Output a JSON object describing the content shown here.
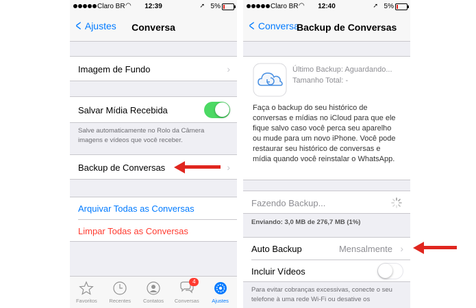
{
  "colors": {
    "ios_blue": "#007aff",
    "ios_red": "#ff3b30",
    "switch_green": "#4cd964",
    "arrow_red": "#e0261f",
    "group_bg": "#efeff4"
  },
  "left": {
    "status": {
      "carrier": "Claro BR",
      "time": "12:39",
      "battery": "5%"
    },
    "nav": {
      "back_label": "Ajustes",
      "title": "Conversa"
    },
    "imagem_fundo": "Imagem de Fundo",
    "salvar_midia": {
      "label": "Salvar Mídia Recebida",
      "on": true
    },
    "salvar_footer": "Salve automaticamente no Rolo da Câmera imagens e vídeos que você receber.",
    "backup_conversas": "Backup de Conversas",
    "arquivar": "Arquivar Todas as Conversas",
    "limpar": "Limpar Todas as Conversas",
    "tabs": [
      {
        "label": "Favoritos",
        "icon": "star-icon"
      },
      {
        "label": "Recentes",
        "icon": "clock-icon"
      },
      {
        "label": "Contatos",
        "icon": "contacts-icon"
      },
      {
        "label": "Conversas",
        "icon": "chat-bubbles-icon",
        "badge": "4"
      },
      {
        "label": "Ajustes",
        "icon": "settings-gear-icon",
        "active": true
      }
    ]
  },
  "right": {
    "status": {
      "carrier": "Claro BR",
      "time": "12:40",
      "battery": "5%"
    },
    "nav": {
      "back_label": "Conversa",
      "title": "Backup de Conversas"
    },
    "ultimo_backup": "Último Backup: Aguardando...",
    "tamanho_total": "Tamanho Total: -",
    "description": "Faça o backup do seu histórico de conversas e mídias no iCloud para que ele fique salvo caso você perca seu aparelho ou mude para um novo iPhone. Você pode restaurar seu histórico de conversas e mídia quando você reinstalar o WhatsApp.",
    "fazendo_backup": "Fazendo Backup...",
    "enviando": "Enviando: 3,0 MB de 276,7 MB (1%)",
    "auto_backup": {
      "label": "Auto Backup",
      "value": "Mensalmente"
    },
    "incluir_videos": {
      "label": "Incluir Vídeos",
      "on": false
    },
    "footer": "Para evitar cobranças excessivas, conecte o seu telefone à uma rede Wi-Fi ou desative os"
  }
}
